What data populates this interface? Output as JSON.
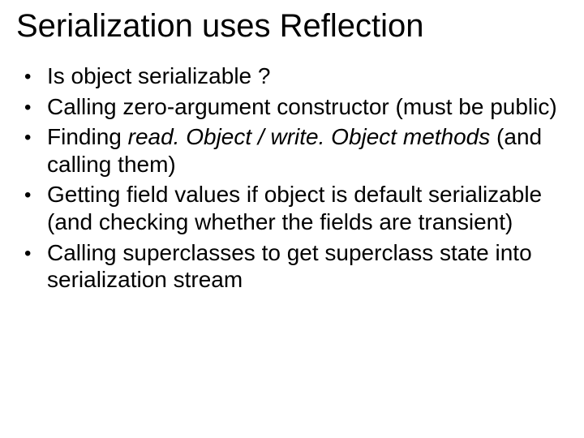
{
  "title": "Serialization uses Reflection",
  "bullets": [
    {
      "pre": "Is object serializable ?",
      "em": "",
      "post": ""
    },
    {
      "pre": "Calling zero-argument constructor (must be public)",
      "em": "",
      "post": ""
    },
    {
      "pre": "Finding ",
      "em": "read. Object / write. Object methods",
      "post": " (and calling them)"
    },
    {
      "pre": "Getting field values if object is default serializable (and checking whether the fields are transient)",
      "em": "",
      "post": ""
    },
    {
      "pre": "Calling superclasses to get superclass state into serialization stream",
      "em": "",
      "post": ""
    }
  ]
}
